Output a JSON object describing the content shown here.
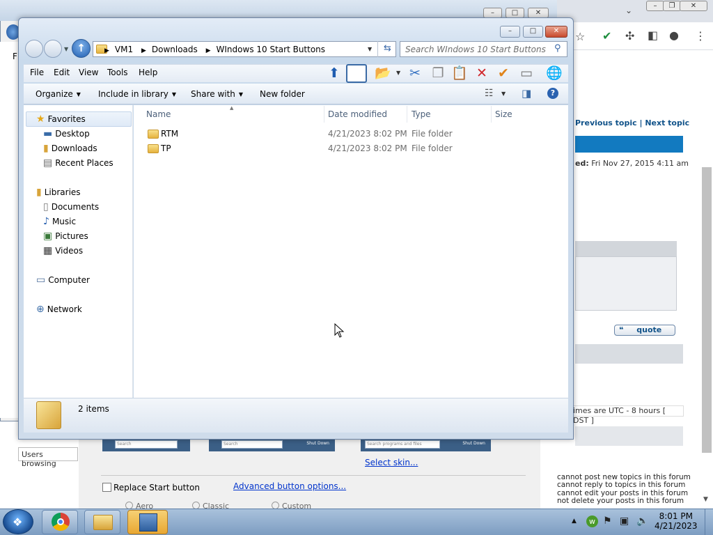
{
  "browser": {
    "forum_prev": "Previous topic",
    "forum_sep": " | ",
    "forum_next": "Next topic",
    "posted_prefix": "ed:",
    "posted_date": " Fri Nov 27, 2015 4:11 am",
    "quote_label": "quote",
    "timezone_text": "imes are UTC - 8 hours [ DST ]",
    "perm_lines": [
      "cannot post new topics in this forum",
      "cannot reply to topics in this forum",
      "cannot edit your posts in this forum",
      "not delete your posts in this forum"
    ]
  },
  "bg_window": {
    "users_browsing": "Users browsing",
    "skin_search_1": "Search",
    "skin_search_2": "Search",
    "skin_shutdown_2": "Shut Down",
    "skin_search_3": "Search programs and files",
    "skin_shutdown_3": "Shut Down",
    "select_skin": "Select skin...",
    "replace_start": "Replace Start button",
    "advanced_options": "Advanced button options...",
    "radio_aero": "Aero",
    "radio_classic": "Classic",
    "radio_custom": "Custom"
  },
  "explorer": {
    "address": {
      "crumbs": [
        "VM1",
        "Downloads",
        "WIndows 10 Start Buttons"
      ]
    },
    "search_placeholder": "Search WIndows 10 Start Buttons",
    "menu": [
      "File",
      "Edit",
      "View",
      "Tools",
      "Help"
    ],
    "commands": {
      "organize": "Organize",
      "include_library": "Include in library",
      "share_with": "Share with",
      "new_folder": "New folder"
    },
    "nav": {
      "favorites": "Favorites",
      "desktop": "Desktop",
      "downloads": "Downloads",
      "recent_places": "Recent Places",
      "libraries": "Libraries",
      "documents": "Documents",
      "music": "Music",
      "pictures": "Pictures",
      "videos": "Videos",
      "computer": "Computer",
      "network": "Network"
    },
    "columns": [
      "Name",
      "Date modified",
      "Type",
      "Size"
    ],
    "files": [
      {
        "name": "RTM",
        "date": "4/21/2023 8:02 PM",
        "type": "File folder"
      },
      {
        "name": "TP",
        "date": "4/21/2023 8:02 PM",
        "type": "File folder"
      }
    ],
    "item_count": "2 items"
  },
  "taskbar": {
    "time": "8:01 PM",
    "date": "4/21/2023"
  }
}
